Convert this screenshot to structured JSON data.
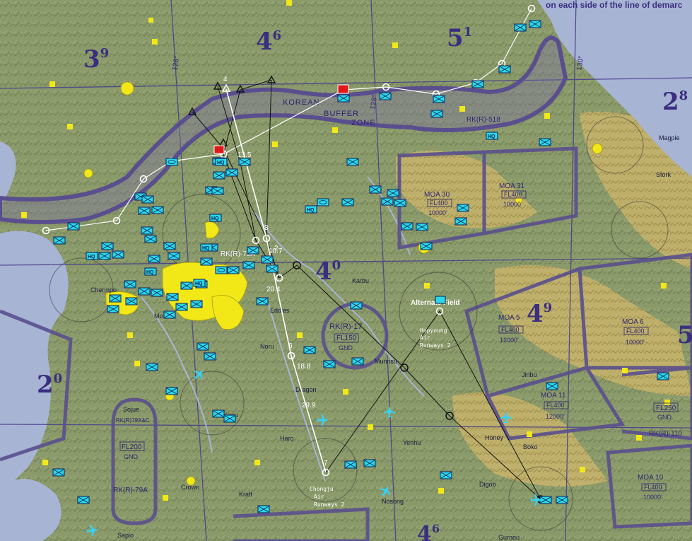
{
  "banner": "on each side of the line of demarc",
  "grid_labels": [
    {
      "main": "3",
      "sup": "9"
    },
    {
      "main": "4",
      "sup": "6"
    },
    {
      "main": "5",
      "sup": "1"
    },
    {
      "main": "2",
      "sup": "8"
    },
    {
      "main": "4",
      "sup": "0"
    },
    {
      "main": "4",
      "sup": "9"
    },
    {
      "main": "2",
      "sup": "0"
    },
    {
      "main": "5",
      "sup": ""
    },
    {
      "main": "4",
      "sup": "6"
    }
  ],
  "meridians": [
    "128°",
    "128°",
    "130°"
  ],
  "buffer_zone": {
    "line1": "KOREAN",
    "line2": "BUFFER",
    "line3": "ZONE"
  },
  "restricted_labels": [
    "RK(R)-518",
    "RK(R)-73A",
    "RK(R)-79A",
    "RK(R)-17",
    "RK(R)-110"
  ],
  "airspace_boxes": [
    {
      "name": "MOA 30",
      "ceiling": "FL400",
      "floor": "10000'"
    },
    {
      "name": "MOA 31",
      "ceiling": "FL400",
      "floor": "10000'"
    },
    {
      "name": "MOA 5",
      "ceiling": "FL400",
      "floor": "12000'"
    },
    {
      "name": "MOA 6",
      "ceiling": "FL400",
      "floor": "10000'"
    },
    {
      "name": "MOA 11",
      "ceiling": "FL400",
      "floor": "12000'"
    },
    {
      "name": "MOA 10",
      "ceiling": "FL400",
      "floor": "10000'"
    },
    {
      "name": "RK(R)-17",
      "ceiling": "FL150",
      "floor": "GND"
    },
    {
      "name": "",
      "ceiling": "FL250",
      "floor": "GND"
    },
    {
      "name": "RK(R)79A&C",
      "ceiling": "FL200",
      "floor": "GND"
    }
  ],
  "place_names": [
    "Magpie",
    "Stork",
    "Karbu",
    "Chermpo",
    "Mo",
    "Eddies",
    "Noru",
    "Dragon",
    "Haro",
    "Kasu",
    "Munnsu",
    "Yenhu",
    "Jinbu",
    "Honey",
    "Boko",
    "Digob",
    "Nosong",
    "Crown",
    "Kraft",
    "Sojue",
    "Sapio",
    "Gurnou"
  ],
  "airfields": {
    "alternate": {
      "title": "Alternate Field",
      "line1": "Hopyoung",
      "line2": "Air",
      "line3": "Runways 2"
    },
    "chongju": {
      "title": "Chongju",
      "line1": "Air",
      "line2": "Runways 2"
    }
  },
  "waypoint_labels": [
    "4",
    "3",
    "6",
    "7",
    "2"
  ],
  "distance_labels": [
    "13.5",
    "10.7",
    "20.4",
    "18.8",
    "29.9"
  ],
  "marker_labels": [
    "HQ",
    "HQ",
    "HQ",
    "HQ",
    "HQ",
    "HQ",
    "HQ",
    "HQ"
  ],
  "colors": {
    "terrain": "#8a9a6a",
    "terrain_high": "#c9b36a",
    "water": "#a7b4d4",
    "airspace": "#5a4f8e",
    "city": "#f2e818",
    "unit": "#2ad8e8",
    "flight_path": "#ffffff",
    "threat_ring": "#1a1a1a"
  }
}
